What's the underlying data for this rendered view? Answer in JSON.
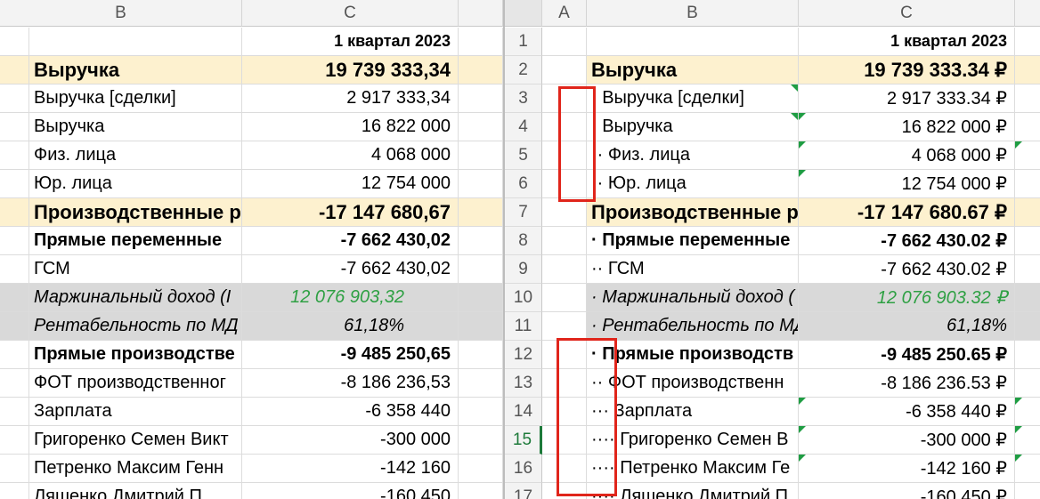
{
  "left": {
    "col_b": "B",
    "col_c": "C",
    "rows": [
      {
        "b": "",
        "c": "1 квартал 2023"
      },
      {
        "b": "Выручка",
        "c": "19 739 333,34"
      },
      {
        "b": "Выручка [сделки]",
        "c": "2 917 333,34"
      },
      {
        "b": "Выручка",
        "c": "16 822 000"
      },
      {
        "b": "Физ. лица",
        "c": "4 068 000"
      },
      {
        "b": "Юр. лица",
        "c": "12 754 000"
      },
      {
        "b": "Производственные р",
        "c": "-17 147 680,67"
      },
      {
        "b": "Прямые переменные",
        "c": "-7 662 430,02"
      },
      {
        "b": "ГСМ",
        "c": "-7 662 430,02"
      },
      {
        "b": "Маржинальный доход (I",
        "c": "12 076 903,32"
      },
      {
        "b": "Рентабельность по МД",
        "c": "61,18%"
      },
      {
        "b": "Прямые производстве",
        "c": "-9 485 250,65"
      },
      {
        "b": "ФОТ производственног",
        "c": "-8 186 236,53"
      },
      {
        "b": "Зарплата",
        "c": "-6 358 440"
      },
      {
        "b": "Григоренко Семен Викт",
        "c": "-300 000"
      },
      {
        "b": "Петренко Максим Генн",
        "c": "-142 160"
      },
      {
        "b": "Ляшенко Дмитрий П",
        "c": "-160 450"
      }
    ]
  },
  "right": {
    "col_a": "A",
    "col_b": "B",
    "col_c": "C",
    "rows": [
      {
        "n": "1",
        "b": "",
        "c": "1 квартал 2023"
      },
      {
        "n": "2",
        "b": "Выручка",
        "c": "19 739 333.34 ₽"
      },
      {
        "n": "3",
        "b": "· Выручка [сделки]",
        "c": "2 917 333.34 ₽"
      },
      {
        "n": "4",
        "b": "· Выручка",
        "c": "16 822 000 ₽"
      },
      {
        "n": "5",
        "b": "·· Физ. лица",
        "c": "4 068 000 ₽"
      },
      {
        "n": "6",
        "b": "·· Юр. лица",
        "c": "12 754 000 ₽"
      },
      {
        "n": "7",
        "b": "Производственные р",
        "c": "-17 147 680.67 ₽"
      },
      {
        "n": "8",
        "b": "· Прямые переменные",
        "c": "-7 662 430.02 ₽"
      },
      {
        "n": "9",
        "b": "·· ГСМ",
        "c": "-7 662 430.02 ₽"
      },
      {
        "n": "10",
        "b": "· Маржинальный доход (",
        "c": "12 076 903.32 ₽"
      },
      {
        "n": "11",
        "b": "· Рентабельность по МД",
        "c": "61,18%"
      },
      {
        "n": "12",
        "b": "· Прямые производств",
        "c": "-9 485 250.65 ₽"
      },
      {
        "n": "13",
        "b": "·· ФОТ производственн",
        "c": "-8 186 236.53 ₽"
      },
      {
        "n": "14",
        "b": "··· Зарплата",
        "c": "-6 358 440 ₽"
      },
      {
        "n": "15",
        "b": "···· Григоренко Семен В",
        "c": "-300 000 ₽"
      },
      {
        "n": "16",
        "b": "···· Петренко Максим Ге",
        "c": "-142 160 ₽"
      },
      {
        "n": "17",
        "b": "···· Ляшенко Дмитрий П",
        "c": "-160 450 ₽"
      }
    ]
  },
  "colors": {
    "highlight_yellow": "#fdf1cf",
    "highlight_grey": "#d9d9d9",
    "margin_green": "#2ea043",
    "annotation_red": "#e0251b",
    "active_row_green": "#1d7a3a"
  }
}
